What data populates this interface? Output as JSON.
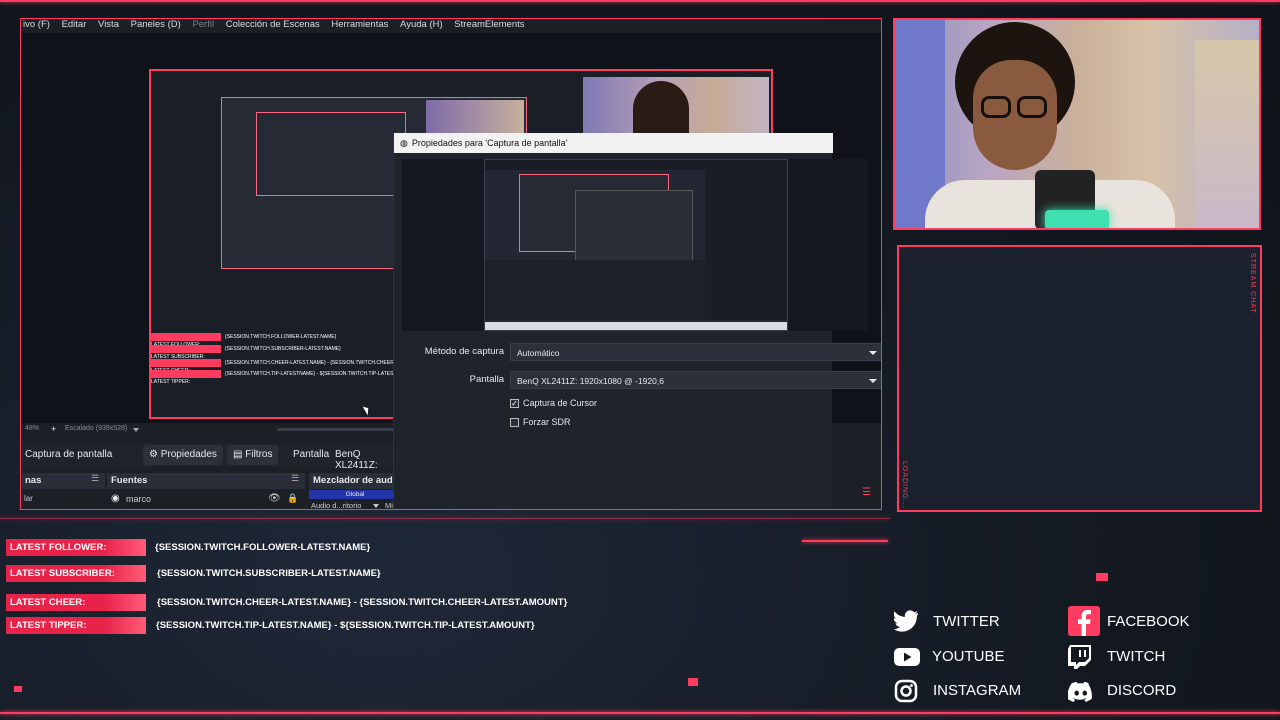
{
  "menu": {
    "items": [
      "ivo (F)",
      "Editar",
      "Vista",
      "Paneles (D)",
      "Perfil",
      "Colección de Escenas",
      "Herramientas",
      "Ayuda (H)",
      "StreamElements"
    ]
  },
  "scenebar": {
    "zoom": "48%",
    "scale": "Escalado (939x528)"
  },
  "propbar": {
    "source_name": "Captura de pantalla",
    "properties": "Propiedades",
    "filters": "Filtros",
    "display_label": "Pantalla",
    "display_value": "BenQ XL2411Z:"
  },
  "docks": {
    "scenes_header": "nas",
    "scenes_item": "lar",
    "sources_header": "Fuentes",
    "source_item": "marco",
    "mixer_header": "Mezclador de audi",
    "mixer_sub": "Global",
    "mixer_item": "Audio d...ritorio",
    "mixer_extra": "Mi"
  },
  "dialog": {
    "title": "Propiedades para 'Captura de pantalla'",
    "method_label": "Método de captura",
    "method_value": "Automático",
    "display_label": "Pantalla",
    "display_value": "BenQ XL2411Z: 1920x1080 @ -1920,6",
    "cursor_label": "Captura de Cursor",
    "cursor_checked": true,
    "sdr_label": "Forzar SDR",
    "sdr_checked": false
  },
  "nested": {
    "labels": [
      "LATEST FOLLOWER:",
      "LATEST SUBSCRIBER:",
      "LATEST CHEER:",
      "LATEST TIPPER:"
    ],
    "values": [
      "{SESSION.TWITCH.FOLLOWER-LATEST.NAME}",
      "{SESSION.TWITCH.SUBSCRIBER-LATEST.NAME}",
      "{SESSION.TWITCH.CHEER-LATEST.NAME} - {SESSION.TWITCH.CHEER-LATEST",
      "{SESSION.TWITCH.TIP-LATESTNAME} - ${SESSION.TWITCH.TIP-LATEST"
    ]
  },
  "chat": {
    "side_top": "STREAM CHAT",
    "side_bottom": "LOADING..."
  },
  "alerts": [
    {
      "label": "LATEST FOLLOWER:",
      "value": "{SESSION.TWITCH.FOLLOWER-LATEST.NAME}"
    },
    {
      "label": "LATEST SUBSCRIBER:",
      "value": "{SESSION.TWITCH.SUBSCRIBER-LATEST.NAME}"
    },
    {
      "label": "LATEST CHEER:",
      "value": "{SESSION.TWITCH.CHEER-LATEST.NAME} - {SESSION.TWITCH.CHEER-LATEST.AMOUNT}"
    },
    {
      "label": "LATEST TIPPER:",
      "value": "{SESSION.TWITCH.TIP-LATEST.NAME} - ${SESSION.TWITCH.TIP-LATEST.AMOUNT}"
    }
  ],
  "socials": [
    {
      "name": "TWITTER",
      "icon": "twitter-icon"
    },
    {
      "name": "FACEBOOK",
      "icon": "facebook-icon"
    },
    {
      "name": "YOUTUBE",
      "icon": "youtube-icon"
    },
    {
      "name": "TWITCH",
      "icon": "twitch-icon"
    },
    {
      "name": "INSTAGRAM",
      "icon": "instagram-icon"
    },
    {
      "name": "DISCORD",
      "icon": "discord-icon"
    }
  ],
  "colors": {
    "accent": "#ff3b5f",
    "background": "#141a24",
    "panel": "#1c1f26"
  }
}
